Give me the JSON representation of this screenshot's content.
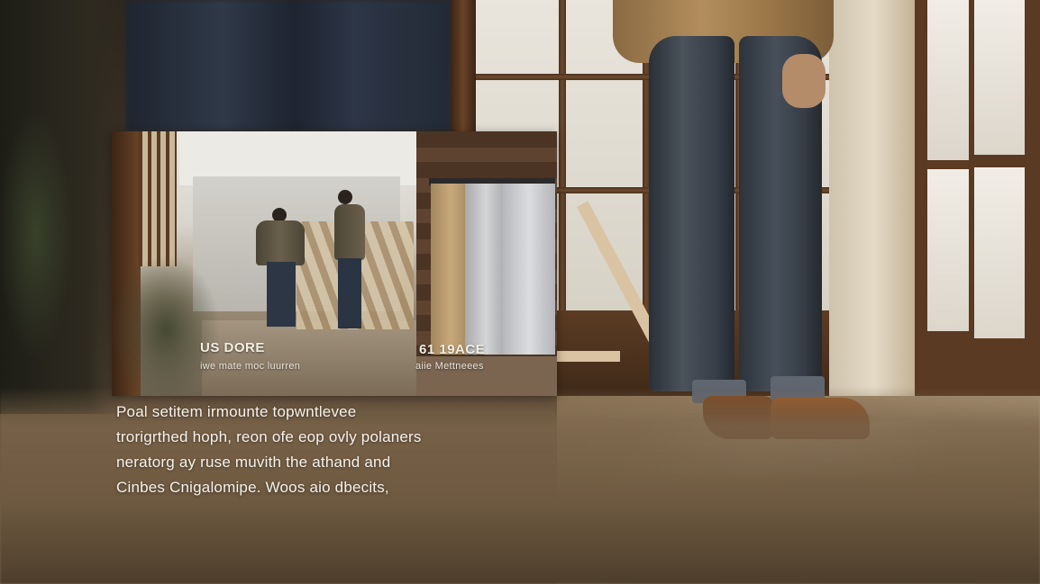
{
  "inset": {
    "left_photo": {
      "title": "US DORE",
      "subtitle": "iwe mate moc luurren"
    },
    "right_photo": {
      "title": "61 19ACE",
      "subtitle": "aiie Mettneees"
    }
  },
  "paragraph": {
    "lines": [
      "Poal setitem irmounte topwntlevee",
      "trorigrthed hoph, reon ofe eop ovly polaners",
      "neratorg ay ruse muvith the athand and",
      "Cinbes Cnigalomipe. Woos aio dbecits,"
    ]
  }
}
